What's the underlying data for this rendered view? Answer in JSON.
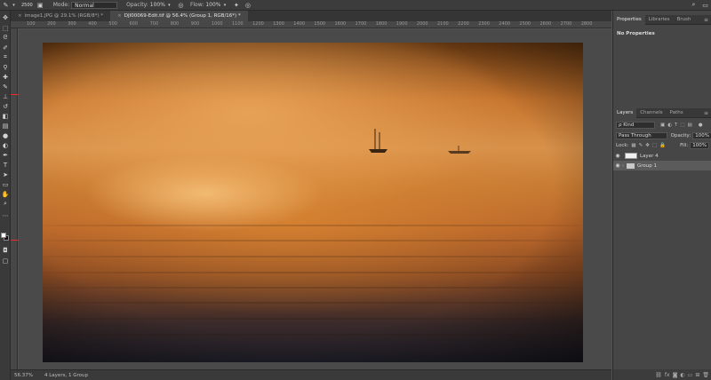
{
  "options_bar": {
    "brush_size": "2500",
    "mode_label": "Mode:",
    "mode_value": "Normal",
    "opacity_label": "Opacity:",
    "opacity_value": "100%",
    "flow_label": "Flow:",
    "flow_value": "100%"
  },
  "doc_tabs": [
    {
      "label": "image1.JPG @ 29.1% (RGB/8*) *"
    },
    {
      "label": "DJI00069-Edit.tif @ 56.4% (Group 1, RGB/16*) *"
    }
  ],
  "ruler_top": [
    "100",
    "200",
    "300",
    "400",
    "500",
    "600",
    "700",
    "800",
    "900",
    "1000",
    "1100",
    "1200",
    "1300",
    "1400",
    "1500",
    "1600",
    "1700",
    "1800",
    "1900",
    "2000",
    "2100",
    "2200",
    "2300",
    "2400",
    "2500",
    "2600",
    "2700",
    "2800"
  ],
  "properties_panel": {
    "tabs": [
      "Properties",
      "Libraries",
      "Brush"
    ],
    "empty_label": "No Properties"
  },
  "layers_panel": {
    "tabs": [
      "Layers",
      "Channels",
      "Paths"
    ],
    "filter_value": "ρ Kind",
    "blend_mode": "Pass Through",
    "opacity_label": "Opacity:",
    "opacity_value": "100%",
    "lock_label": "Lock:",
    "fill_label": "Fill:",
    "fill_value": "100%",
    "layers": [
      {
        "name": "Layer 4"
      },
      {
        "name": "Group 1"
      }
    ]
  },
  "status_bar": {
    "zoom": "56.37%",
    "info": "4 Layers, 1 Group"
  },
  "icons": {
    "tools": [
      "move-icon",
      "marquee-icon",
      "lasso-icon",
      "quick-select-icon",
      "crop-icon",
      "eyedropper-icon",
      "healing-icon",
      "brush-icon",
      "stamp-icon",
      "history-brush-icon",
      "eraser-icon",
      "gradient-icon",
      "blur-icon",
      "dodge-icon",
      "pen-icon",
      "type-icon",
      "path-select-icon",
      "shape-icon",
      "hand-icon",
      "zoom-icon",
      "more-tools-icon"
    ]
  },
  "colors": {
    "foreground": "#ffffff",
    "background": "#111111"
  }
}
